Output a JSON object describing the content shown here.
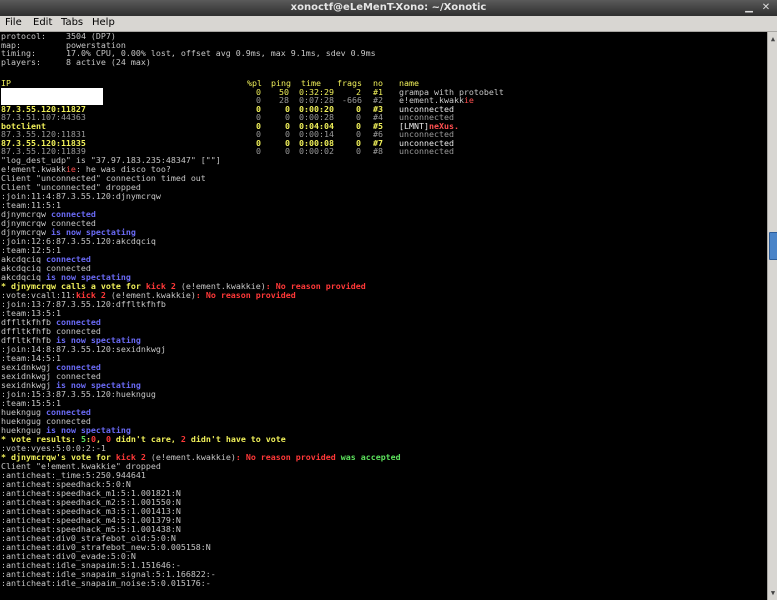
{
  "window": {
    "title": "xonoctf@eLeMenT-Xono: ~/Xonotic"
  },
  "menu": {
    "file": "File",
    "edit": "Edit",
    "tabs": "Tabs",
    "help": "Help"
  },
  "status": {
    "protocol_label": "protocol:",
    "protocol_value": "3504 (DP7)",
    "map_label": "map:",
    "map_value": "powerstation",
    "timing_label": "timing:",
    "timing_value": "17.0% CPU, 0.00% lost, offset avg 0.9ms, max 9.1ms, sdev 0.9ms",
    "players_label": "players:",
    "players_value": "8 active (24 max)"
  },
  "players_table": {
    "headers": {
      "ip": "IP",
      "pl": "%pl",
      "ping": "ping",
      "time": "time",
      "frags": "frags",
      "no": "no",
      "name": "name"
    },
    "rows": [
      {
        "ip": "",
        "pl": "0",
        "ping": "50",
        "time": "0:32:29",
        "frags": "2",
        "no": "#1",
        "name": "grampa with protobelt"
      },
      {
        "ip": "",
        "pl": "0",
        "ping": "28",
        "time": "0:07:28",
        "frags": "-666",
        "no": "#2",
        "name_a": "e!ement.kwakk",
        "name_b": "ie"
      },
      {
        "ip": "87.3.55.120:11827",
        "pl": "0",
        "ping": "0",
        "time": "0:00:20",
        "frags": "0",
        "no": "#3",
        "name": "unconnected"
      },
      {
        "ip": "87.3.51.107:44363",
        "pl": "0",
        "ping": "0",
        "time": "0:00:28",
        "frags": "0",
        "no": "#4",
        "name": "unconnected"
      },
      {
        "ip": "botclient",
        "pl": "0",
        "ping": "0",
        "time": "0:04:04",
        "frags": "0",
        "no": "#5",
        "name_a": "[LMNT]",
        "name_b": "neXus."
      },
      {
        "ip": "87.3.55.120:11831",
        "pl": "0",
        "ping": "0",
        "time": "0:00:14",
        "frags": "0",
        "no": "#6",
        "name": "unconnected"
      },
      {
        "ip": "87.3.55.120:11835",
        "pl": "0",
        "ping": "0",
        "time": "0:00:08",
        "frags": "0",
        "no": "#7",
        "name": "unconnected"
      },
      {
        "ip": "87.3.55.120:11839",
        "pl": "0",
        "ping": "0",
        "time": "0:00:02",
        "frags": "0",
        "no": "#8",
        "name": "unconnected"
      }
    ]
  },
  "log": {
    "l01": "\"log_dest_udp\" is \"37.97.183.235:48347\" [\"\"]",
    "l02a": "e!ement.kwakk",
    "l02b": "ie",
    "l02c": ": he was disco too?",
    "l03": "Client \"unconnected\" connection timed out",
    "l04": "Client \"unconnected\" dropped",
    "l05": ":join:11:4:87.3.55.120:djnymcrqw",
    "l06": ":team:11:5:1",
    "l07a": "djnymcrqw",
    "l07b": " connected",
    "l08": "djnymcrqw connected",
    "l09a": "djnymcrqw",
    "l09b": " is now spectating",
    "l10": ":join:12:6:87.3.55.120:akcdqciq",
    "l11": ":team:12:5:1",
    "l12a": "akcdqciq",
    "l12b": " connected",
    "l13": "akcdqciq connected",
    "l14a": "akcdqciq",
    "l14b": " is now spectating",
    "l15a": "* ",
    "l15b": "djnymcrqw",
    "l15c": " calls a vote for ",
    "l15d": "kick 2",
    "l15e": " (e!ement.kwakkie)",
    "l15f": ": No reason provided",
    "l16a": ":vote:vcall:11:",
    "l16b": "kick 2",
    "l16c": " (e!ement.kwakkie)",
    "l16d": ": No reason provided",
    "l17": ":join:13:7:87.3.55.120:dffltkfhfb",
    "l18": ":team:13:5:1",
    "l19a": "dffltkfhfb",
    "l19b": " connected",
    "l20": "dffltkfhfb connected",
    "l21a": "dffltkfhfb",
    "l21b": " is now spectating",
    "l22": ":join:14:8:87.3.55.120:sexidnkwgj",
    "l23": ":team:14:5:1",
    "l24a": "sexidnkwgj",
    "l24b": " connected",
    "l25": "sexidnkwgj connected",
    "l26a": "sexidnkwgj",
    "l26b": " is now spectating",
    "l27": ":join:15:3:87.3.55.120:huekngug",
    "l28": ":team:15:5:1",
    "l29a": "huekngug",
    "l29b": " connected",
    "l30": "huekngug connected",
    "l31a": "huekngug",
    "l31b": " is now spectating",
    "l32a": "* vote results: ",
    "l32b": "5",
    "l32c": ":",
    "l32d": "0",
    "l32e": ", ",
    "l32f": "0",
    "l32g": " didn't care, ",
    "l32h": "2",
    "l32i": " didn't have to vote",
    "l33": ":vote:vyes:5:0:0:2:-1",
    "l34a": "* ",
    "l34b": "djnymcrqw",
    "l34c": "'s vote for ",
    "l34d": "kick 2",
    "l34e": " (e!ement.kwakkie)",
    "l34f": ": No reason provided",
    "l34g": " was accepted",
    "l35": "Client \"e!ement.kwakkie\" dropped",
    "l36": ":anticheat:_time:5:250.944641",
    "l37": ":anticheat:speedhack:5:0:N",
    "l38": ":anticheat:speedhack_m1:5:1.001821:N",
    "l39": ":anticheat:speedhack_m2:5:1.001550:N",
    "l40": ":anticheat:speedhack_m3:5:1.001413:N",
    "l41": ":anticheat:speedhack_m4:5:1.001379:N",
    "l42": ":anticheat:speedhack_m5:5:1.001438:N",
    "l43": ":anticheat:div0_strafebot_old:5:0:N",
    "l44": ":anticheat:div0_strafebot_new:5:0.005158:N",
    "l45": ":anticheat:div0_evade:5:0:N",
    "l46": ":anticheat:idle_snapaim:5:1.151646:-",
    "l47": ":anticheat:idle_snapaim_signal:5:1.166822:-",
    "l48": ":anticheat:idle_snapaim_noise:5:0.015176:-"
  },
  "colors": {
    "background": "#000000",
    "text": "#c6c6c6",
    "blue": "#6a6af5",
    "red": "#ff3838",
    "green": "#5ce05c",
    "yellow": "#f1f15a"
  }
}
